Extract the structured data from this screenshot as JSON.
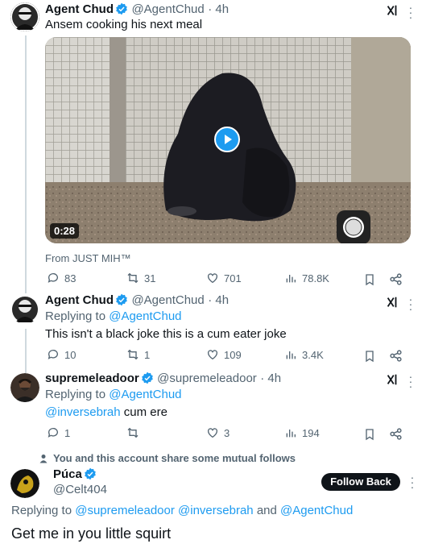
{
  "tweet1": {
    "name": "Agent Chud",
    "handle": "@AgentChud",
    "time": "· 4h",
    "text": "Ansem cooking his next meal",
    "video_duration": "0:28",
    "source": "From JUST MIH™",
    "replies": "83",
    "retweets": "31",
    "likes": "701",
    "views": "78.8K"
  },
  "tweet2": {
    "name": "Agent Chud",
    "handle": "@AgentChud",
    "time": "· 4h",
    "replying_label": "Replying to",
    "replying_to": "@AgentChud",
    "text": "This isn't a black joke this is a cum eater joke",
    "replies": "10",
    "retweets": "1",
    "likes": "109",
    "views": "3.4K"
  },
  "tweet3": {
    "name": "supremeleadoor",
    "handle": "@supremeleadoor",
    "time": "· 4h",
    "replying_label": "Replying to",
    "replying_to": "@AgentChud",
    "mention": "@inversebrah",
    "text": " cum ere",
    "replies": "1",
    "retweets": "",
    "likes": "3",
    "views": "194"
  },
  "mutual": {
    "text": "You and this account share some mutual follows"
  },
  "tweet4": {
    "name": "Púca",
    "handle": "@Celt404",
    "follow_label": "Follow Back",
    "replying_label": "Replying to",
    "mention1": "@supremeleadoor",
    "mention2": "@inversebrah",
    "and_label": "and",
    "mention3": "@AgentChud",
    "text": "Get me in you little squirt"
  },
  "colors": {
    "accent": "#1d9bf0",
    "muted": "#536471",
    "text": "#0f1419"
  }
}
